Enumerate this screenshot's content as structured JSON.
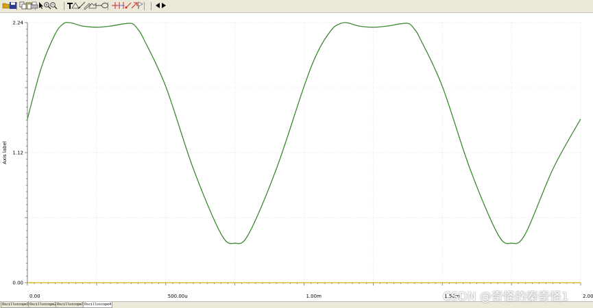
{
  "toolbar": {
    "buttons": [
      {
        "name": "open-icon",
        "color": "#d4a017"
      },
      {
        "name": "save-icon",
        "color": "#2a3d8f"
      },
      {
        "name": "copy-icon",
        "color": "#444444"
      },
      {
        "name": "paste-icon",
        "color": "#444444"
      },
      {
        "name": "print-icon",
        "color": "#444444"
      },
      {
        "name": "select-pointer-icon",
        "color": "#000000"
      },
      {
        "name": "zoom-in-icon",
        "color": "#333333"
      },
      {
        "name": "zoom-out-icon",
        "color": "#333333"
      },
      {
        "name": "text-icon",
        "color": "#000000"
      },
      {
        "name": "property-icon",
        "color": "#444444"
      },
      {
        "name": "draw-line-icon",
        "color": "#444444"
      },
      {
        "name": "pen-icon",
        "color": "#444444"
      },
      {
        "name": "shape-icon",
        "color": "#444444"
      },
      {
        "name": "line-icon",
        "color": "#444444"
      },
      {
        "name": "ellipse-icon",
        "color": "#444444"
      },
      {
        "name": "cursor-cross-icon",
        "color": "#cc2222"
      },
      {
        "name": "cursor-pair-icon",
        "color": "#cc2222"
      },
      {
        "name": "marker-icon",
        "color": "#cc2222"
      },
      {
        "name": "arrow-up-right-icon",
        "color": "#cc2222"
      },
      {
        "name": "flag-icon",
        "color": "#444444"
      },
      {
        "name": "step-left-icon",
        "color": "#000000"
      },
      {
        "name": "step-right-icon",
        "color": "#000000"
      }
    ]
  },
  "chart_data": {
    "type": "line",
    "title": "",
    "xlabel": "",
    "ylabel": "Axis label",
    "xlim": [
      0,
      0.002
    ],
    "ylim": [
      0,
      2.24
    ],
    "x_tick_labels": [
      {
        "value": 0,
        "label": "0.00"
      },
      {
        "value": 0.0005,
        "label": "500.00u"
      },
      {
        "value": 0.001,
        "label": "1.00m"
      },
      {
        "value": 0.0015,
        "label": "1.50m"
      },
      {
        "value": 0.002,
        "label": "2.00m"
      }
    ],
    "y_tick_labels": [
      {
        "value": 0,
        "label": "0.00"
      },
      {
        "value": 1.12,
        "label": "1.12"
      },
      {
        "value": 2.24,
        "label": "2.24"
      }
    ],
    "grid": true,
    "series": [
      {
        "color": "#3a8a2e",
        "x": [
          0,
          5e-05,
          0.0001,
          0.00013,
          0.00015,
          0.00017,
          0.0002,
          0.00025,
          0.0003,
          0.00035,
          0.00038,
          0.0004,
          0.00042,
          0.0005,
          0.0006,
          0.0007,
          0.00075,
          0.0008,
          0.0009,
          0.001,
          0.00105,
          0.0011,
          0.00113,
          0.00115,
          0.00117,
          0.0012,
          0.00125,
          0.0013,
          0.00135,
          0.00138,
          0.0014,
          0.00142,
          0.0015,
          0.0016,
          0.0017,
          0.00175,
          0.0018,
          0.0019,
          0.002
        ],
        "y": [
          1.41,
          1.85,
          2.14,
          2.23,
          2.24,
          2.23,
          2.21,
          2.2,
          2.21,
          2.23,
          2.23,
          2.18,
          2.1,
          1.69,
          0.98,
          0.42,
          0.34,
          0.42,
          0.98,
          1.69,
          1.99,
          2.18,
          2.23,
          2.24,
          2.23,
          2.21,
          2.2,
          2.21,
          2.23,
          2.23,
          2.18,
          2.1,
          1.69,
          0.98,
          0.42,
          0.34,
          0.42,
          0.98,
          1.41
        ]
      },
      {
        "color": "#c8b400",
        "x": [
          0,
          0.002
        ],
        "y": [
          0,
          0
        ]
      }
    ]
  },
  "tabs": [
    {
      "label": "Oscilloscope1",
      "active": false
    },
    {
      "label": "Oscilloscope2",
      "active": false
    },
    {
      "label": "Oscilloscope3",
      "active": false
    },
    {
      "label": "Oscilloscope4",
      "active": true
    }
  ],
  "watermark": "CSDN @奇怪的秦奇怪1"
}
